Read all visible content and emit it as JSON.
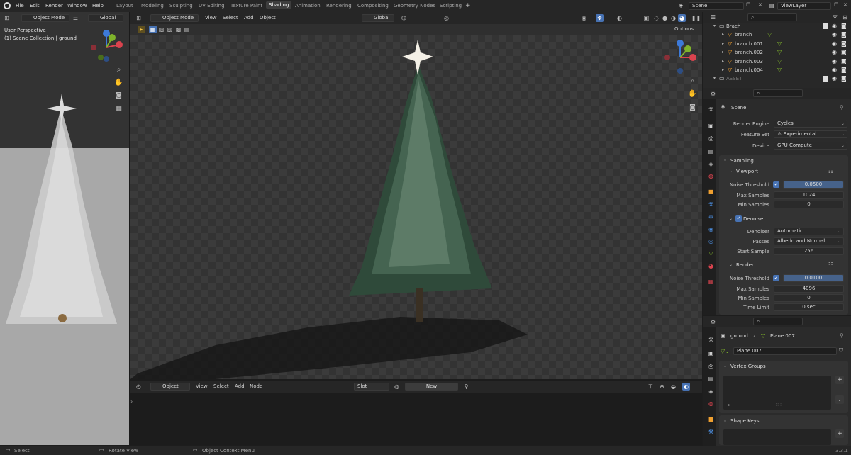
{
  "menu": [
    "File",
    "Edit",
    "Render",
    "Window",
    "Help"
  ],
  "workspace_tabs": [
    "Layout",
    "Modeling",
    "Sculpting",
    "UV Editing",
    "Texture Paint",
    "Shading",
    "Animation",
    "Rendering",
    "Compositing",
    "Geometry Nodes",
    "Scripting"
  ],
  "active_tab": "Shading",
  "scene_name": "Scene",
  "view_layer": "ViewLayer",
  "left_viewport": {
    "mode": "Object Mode",
    "orientation": "Global",
    "overlay_line1": "User Perspective",
    "overlay_line2": "(1) Scene Collection | ground"
  },
  "main_viewport": {
    "mode": "Object Mode",
    "menus": [
      "View",
      "Select",
      "Add",
      "Object"
    ],
    "orientation": "Global",
    "options": "Options"
  },
  "outliner": {
    "rows": [
      {
        "name": "Brach",
        "level": 0
      },
      {
        "name": "branch",
        "level": 1
      },
      {
        "name": "branch.001",
        "level": 1
      },
      {
        "name": "branch.002",
        "level": 1
      },
      {
        "name": "branch.003",
        "level": 1
      },
      {
        "name": "branch.004",
        "level": 1
      },
      {
        "name": "ASSET",
        "level": 0
      }
    ]
  },
  "properties": {
    "context": "Scene",
    "render_engine_label": "Render Engine",
    "render_engine": "Cycles",
    "feature_set_label": "Feature Set",
    "feature_set": "Experimental",
    "device_label": "Device",
    "device": "GPU Compute",
    "sampling": "Sampling",
    "viewport": "Viewport",
    "noise_threshold_label": "Noise Threshold",
    "vp_noise_threshold": "0.0500",
    "max_samples_label": "Max Samples",
    "vp_max_samples": "1024",
    "min_samples_label": "Min Samples",
    "vp_min_samples": "0",
    "denoise": "Denoise",
    "denoiser_label": "Denoiser",
    "denoiser": "Automatic",
    "passes_label": "Passes",
    "passes": "Albedo and Normal",
    "start_sample_label": "Start Sample",
    "start_sample": "256",
    "render": "Render",
    "r_noise_threshold": "0.0100",
    "r_max_samples": "4096",
    "r_min_samples": "0",
    "time_limit_label": "Time Limit",
    "time_limit": "0 sec"
  },
  "data_props": {
    "object": "ground",
    "mesh": "Plane.007",
    "mesh_field": "Plane.007",
    "vertex_groups": "Vertex Groups",
    "shape_keys": "Shape Keys"
  },
  "shader_editor": {
    "type": "Object",
    "menus": [
      "View",
      "Select",
      "Add",
      "Node"
    ],
    "slot": "Slot",
    "new": "New"
  },
  "status_bar": {
    "select": "Select",
    "rotate": "Rotate View",
    "context": "Object Context Menu",
    "version": "3.3.1"
  },
  "colors": {
    "accent": "#4772b3",
    "axis_x": "#d9434e",
    "axis_y": "#7fb32b",
    "axis_z": "#3d7ad9"
  }
}
